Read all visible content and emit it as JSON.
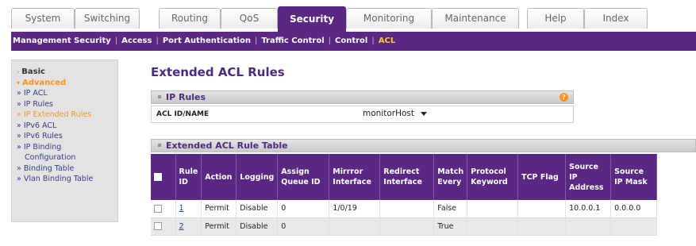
{
  "tabs": [
    {
      "label": "System",
      "active": false
    },
    {
      "label": "Switching",
      "active": false
    },
    {
      "label": "Routing",
      "active": false
    },
    {
      "label": "QoS",
      "active": false
    },
    {
      "label": "Security",
      "active": true
    },
    {
      "label": "Monitoring",
      "active": false
    },
    {
      "label": "Maintenance",
      "active": false
    },
    {
      "label": "Help",
      "active": false
    },
    {
      "label": "Index",
      "active": false
    }
  ],
  "subnav": [
    {
      "label": "Management Security",
      "active": false
    },
    {
      "label": "Access",
      "active": false
    },
    {
      "label": "Port Authentication",
      "active": false
    },
    {
      "label": "Traffic Control",
      "active": false
    },
    {
      "label": "Control",
      "active": false
    },
    {
      "label": "ACL",
      "active": true
    }
  ],
  "sidebar": {
    "basic": "Basic",
    "advanced": "Advanced",
    "items": [
      "» IP ACL",
      "» IP Rules",
      "» IP Extended Rules",
      "» IPv6 ACL",
      "» IPv6 Rules",
      "» IP Binding",
      "Configuration",
      "» Binding Table",
      "» Vlan Binding Table"
    ]
  },
  "main": {
    "title": "Extended ACL Rules",
    "ip_rules": {
      "heading": "IP Rules",
      "acl_label": "ACL ID/NAME",
      "acl_value": "monitorHost"
    },
    "rule_table": {
      "heading": "Extended ACL Rule Table",
      "columns": [
        "",
        "Rule ID",
        "Action",
        "Logging",
        "Assign Queue ID",
        "Mirrror Interface",
        "Redirect Interface",
        "Match Every",
        "Protocol Keyword",
        "TCP Flag",
        "Source IP Address",
        "Source IP Mask"
      ],
      "rows": [
        [
          "1",
          "Permit",
          "Disable",
          "0",
          "1/0/19",
          "",
          "False",
          "",
          "",
          "10.0.0.1",
          "0.0.0.0"
        ],
        [
          "2",
          "Permit",
          "Disable",
          "0",
          "",
          "",
          "True",
          "",
          "",
          "",
          ""
        ]
      ]
    }
  },
  "colors": {
    "brand_purple": "#5a2782",
    "accent_orange": "#f7931e",
    "subnav_active": "#ffcc33"
  }
}
